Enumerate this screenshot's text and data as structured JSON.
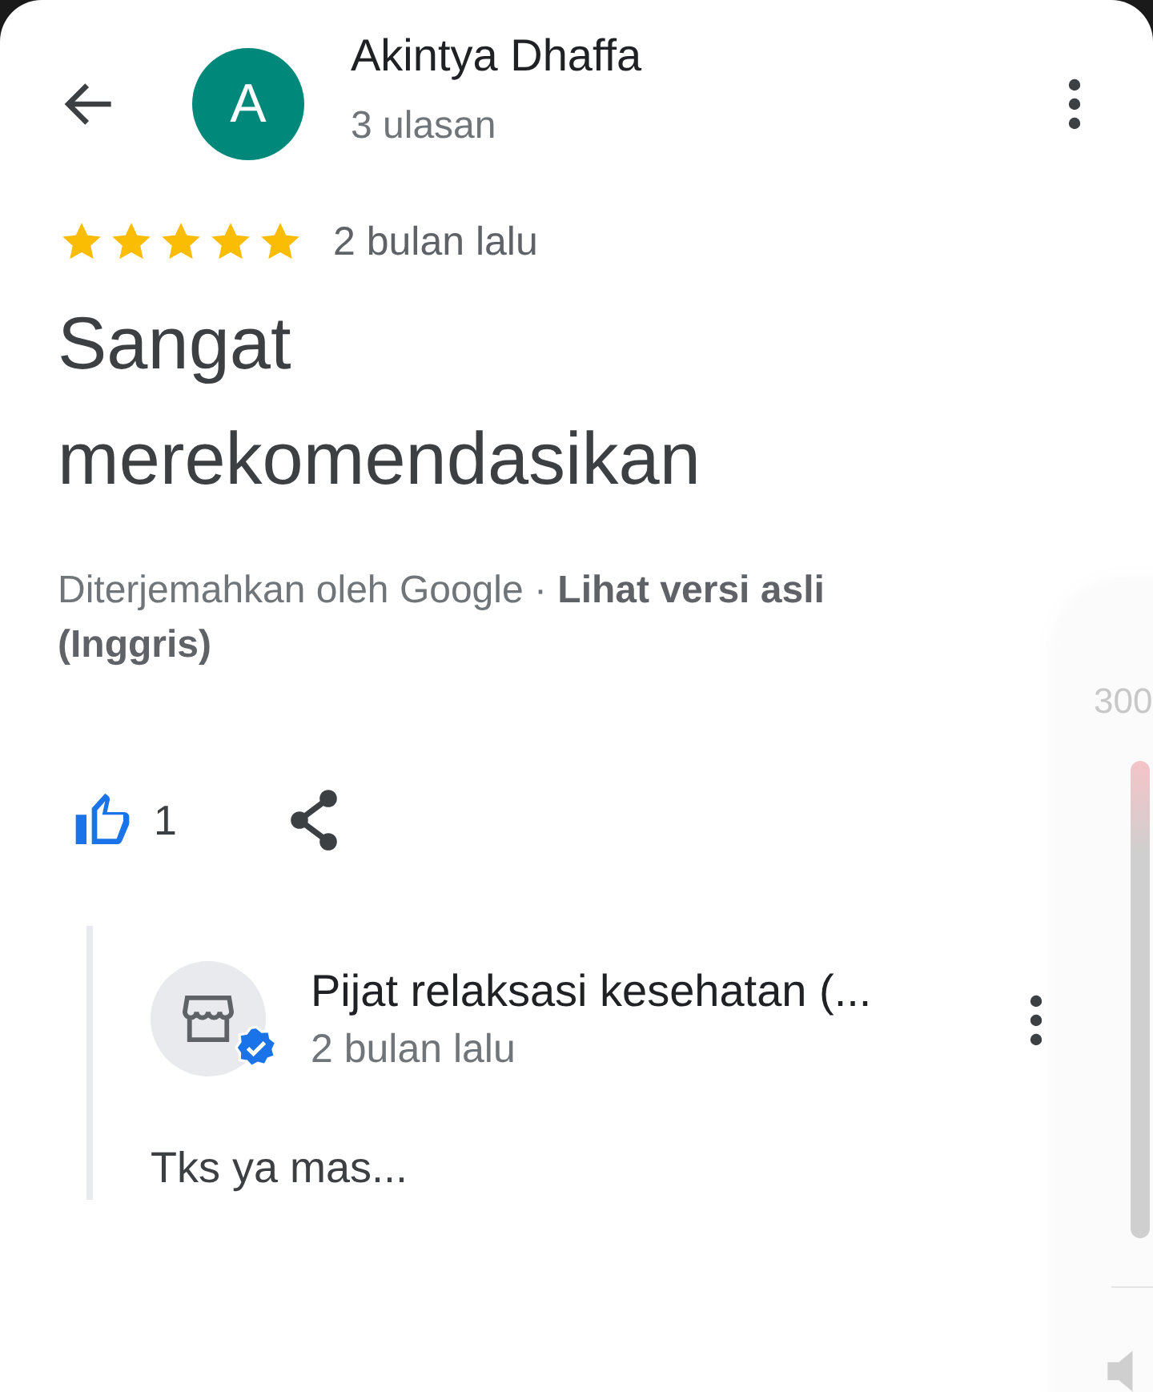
{
  "header": {
    "avatar_letter": "A",
    "name": "Akintya Dhaffa",
    "subtitle": "3 ulasan"
  },
  "review": {
    "stars": 5,
    "time": "2 bulan lalu",
    "text": "Sangat merekomendasikan",
    "translation": "Diterjemahkan oleh Google · **Lihat versi asli (Inggris)**"
  },
  "actions": {
    "liked": true,
    "like_count": "1"
  },
  "reply": {
    "name": "Pijat relaksasi kesehatan (...",
    "verified": true,
    "time": "2 bulan lalu",
    "text": "Tks ya mas..."
  },
  "volume_overlay": {
    "reading": "300",
    "level": 1
  }
}
